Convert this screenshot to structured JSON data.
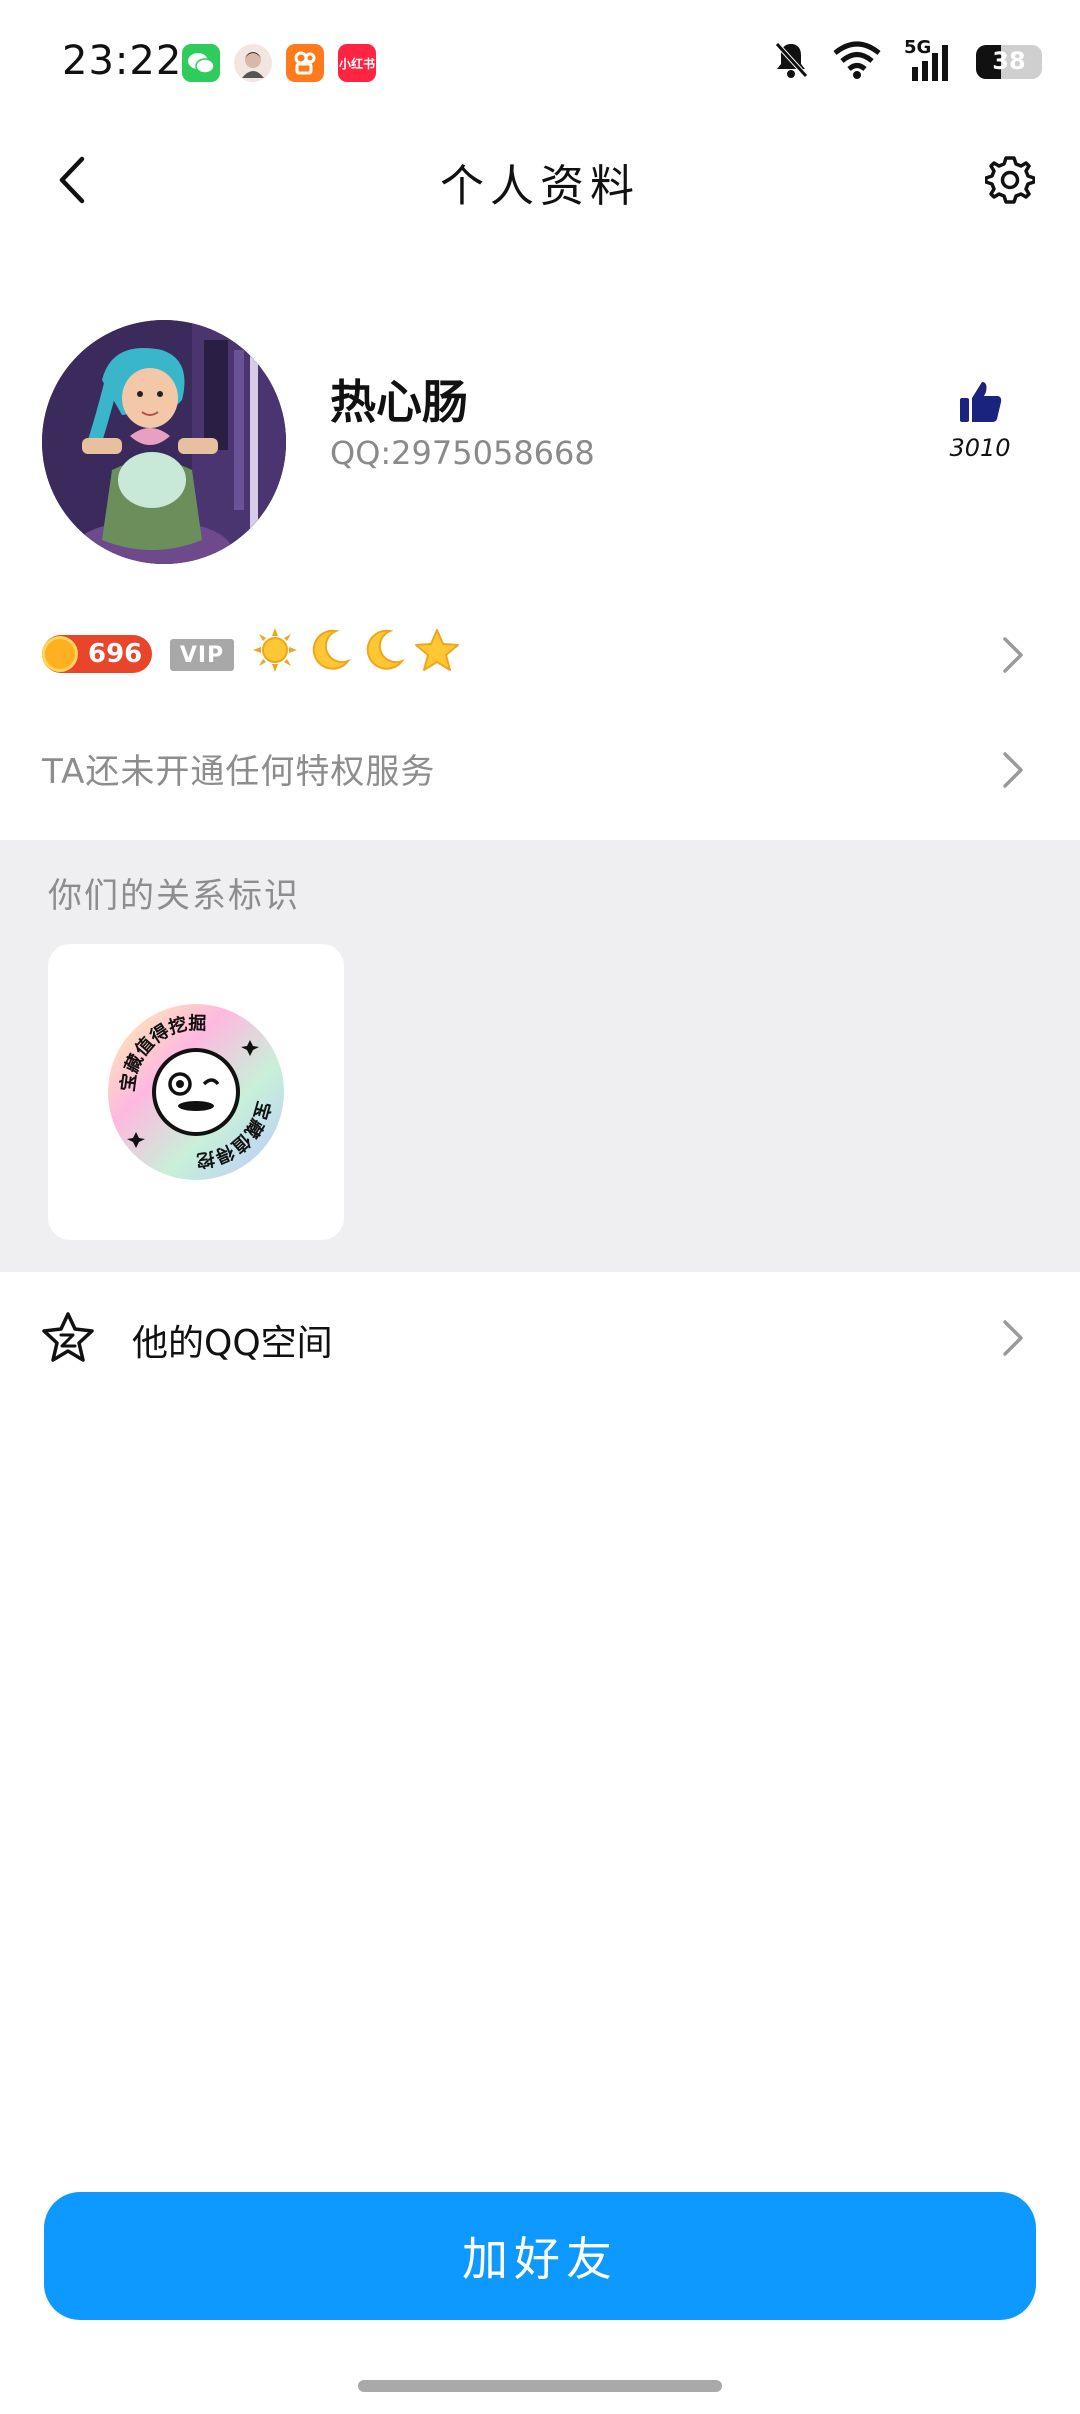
{
  "status_bar": {
    "time": "23:22",
    "network": "5G",
    "battery_level": "38",
    "xhs_label": "小红书"
  },
  "nav": {
    "title": "个人资料"
  },
  "profile": {
    "nickname": "热心肠",
    "qq_number": "QQ:2975058668",
    "like_count": "3010"
  },
  "badges": {
    "level_number": "696",
    "vip_label": "VIP"
  },
  "privilege": {
    "text": "TA还未开通任何特权服务"
  },
  "relation": {
    "title": "你们的关系标识",
    "badge_text": "宝藏值得挖掘"
  },
  "qzone": {
    "label": "他的QQ空间"
  },
  "actions": {
    "add_friend": "加好友"
  },
  "colors": {
    "primary_button": "#0d99ff",
    "like_icon": "#1a237e",
    "section_bg": "#efeff1",
    "level_badge": "#e8452b"
  }
}
